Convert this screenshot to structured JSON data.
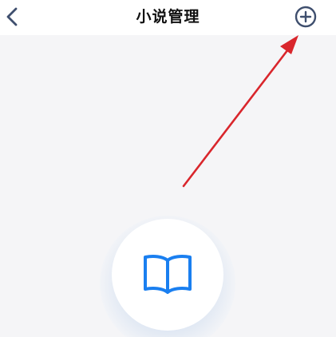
{
  "navbar": {
    "title": "小说管理",
    "back_icon": "chevron-left-icon",
    "add_icon": "plus-circle-icon"
  },
  "empty_state": {
    "icon": "book-open-icon"
  },
  "annotation": {
    "arrow_color": "#d9262c",
    "points_to": "add-button"
  },
  "colors": {
    "icon_dark": "#3f4f6e",
    "accent_blue": "#1a7ff0",
    "background": "#f5f5f7",
    "navbar_bg": "#ffffff"
  }
}
